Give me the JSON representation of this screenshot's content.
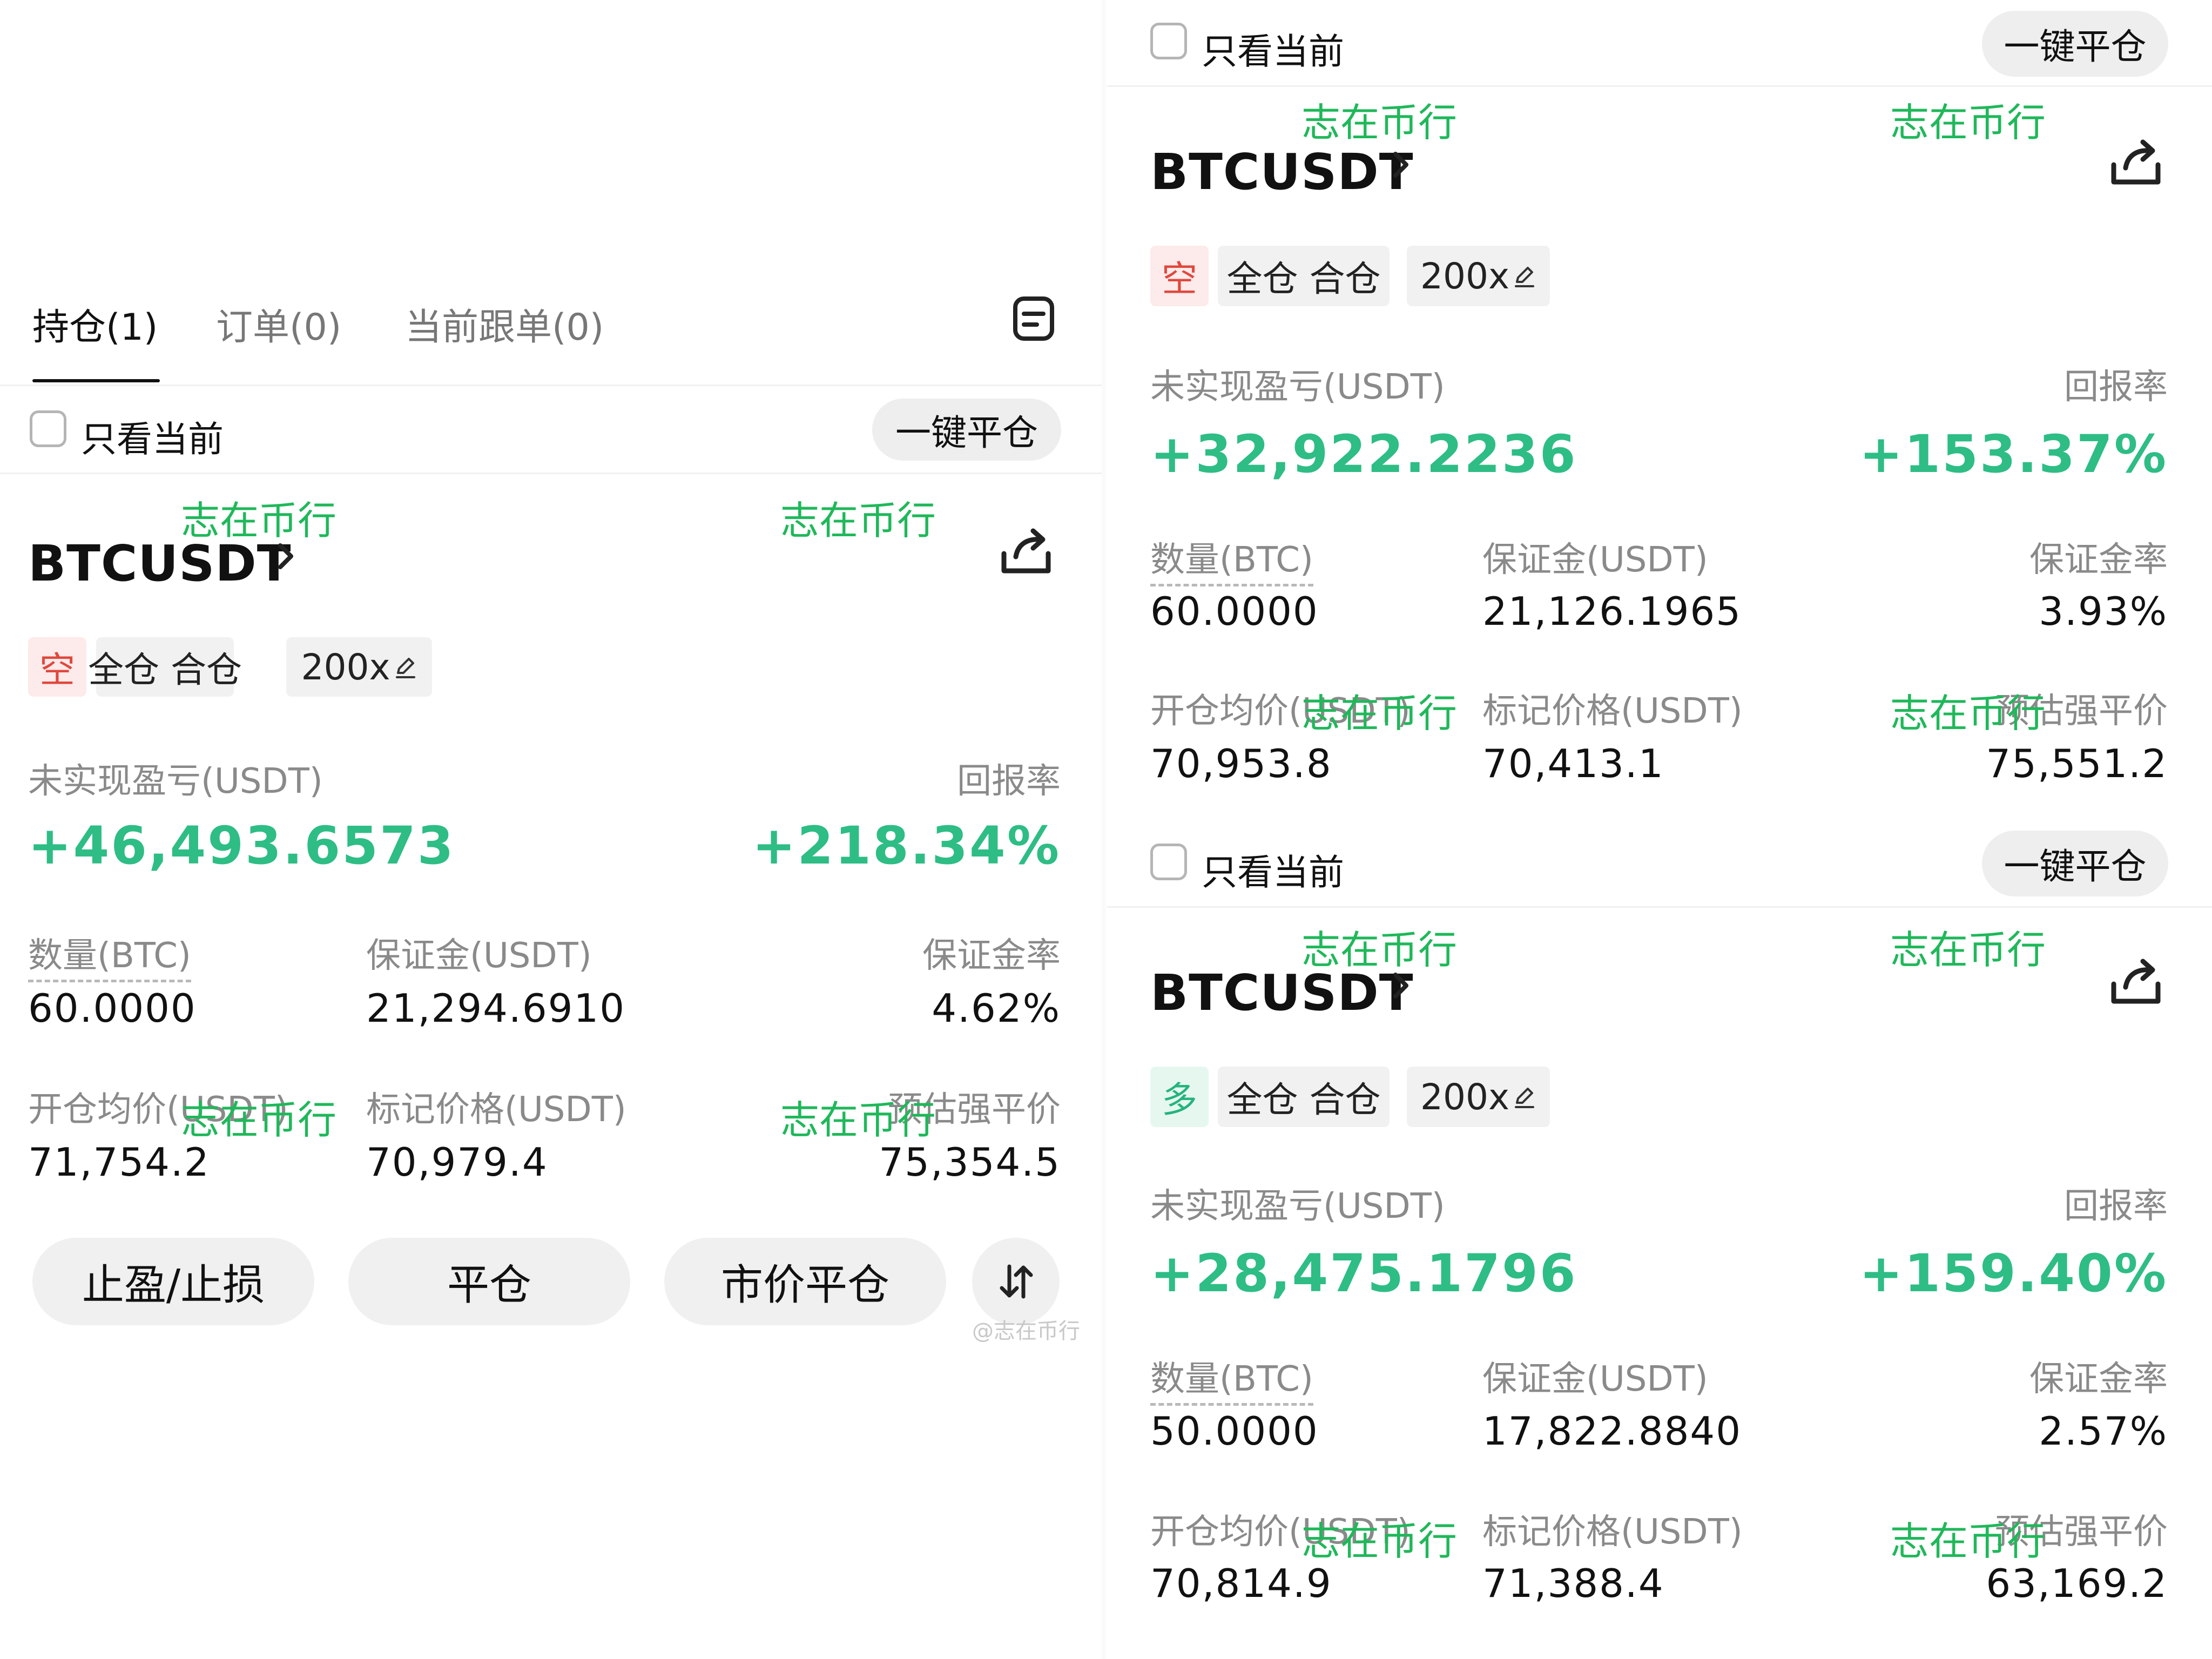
{
  "tabs": [
    {
      "label": "持仓(1)",
      "active": true
    },
    {
      "label": "订单(0)",
      "active": false
    },
    {
      "label": "当前跟单(0)",
      "active": false
    }
  ],
  "filter": {
    "checkbox_label": "只看当前",
    "close_all": "一键平仓"
  },
  "labels": {
    "unrealized_pnl": "未实现盈亏(USDT)",
    "roe": "回报率",
    "qty": "数量(BTC)",
    "margin": "保证金(USDT)",
    "margin_ratio": "保证金率",
    "entry": "开仓均价(USDT)",
    "mark": "标记价格(USDT)",
    "liq": "预估强平价"
  },
  "tags": {
    "mode": "全仓 合仓",
    "leverage": "200x"
  },
  "positions": [
    {
      "symbol": "BTCUSDT",
      "side": "空",
      "side_type": "short",
      "pnl": "+46,493.6573",
      "roe": "+218.34%",
      "qty": "60.0000",
      "margin": "21,294.6910",
      "margin_ratio": "4.62%",
      "entry": "71,754.2",
      "mark": "70,979.4",
      "liq": "75,354.5"
    },
    {
      "symbol": "BTCUSDT",
      "side": "空",
      "side_type": "short",
      "pnl": "+32,922.2236",
      "roe": "+153.37%",
      "qty": "60.0000",
      "margin": "21,126.1965",
      "margin_ratio": "3.93%",
      "entry": "70,953.8",
      "mark": "70,413.1",
      "liq": "75,551.2"
    },
    {
      "symbol": "BTCUSDT",
      "side": "多",
      "side_type": "long",
      "pnl": "+28,475.1796",
      "roe": "+159.40%",
      "qty": "50.0000",
      "margin": "17,822.8840",
      "margin_ratio": "2.57%",
      "entry": "70,814.9",
      "mark": "71,388.4",
      "liq": "63,169.2"
    }
  ],
  "actions": {
    "tp_sl": "止盈/止损",
    "close": "平仓",
    "market_close": "市价平仓"
  },
  "watermark": "志在币行",
  "credit": "@志在币行",
  "colors": {
    "profit_green": "#2ebd85",
    "short_red": "#e0483d",
    "watermark_green": "#1fb85a"
  },
  "icons": [
    "notes-icon",
    "chevron-right-icon",
    "share-icon",
    "edit-icon",
    "sort-arrows-icon"
  ]
}
